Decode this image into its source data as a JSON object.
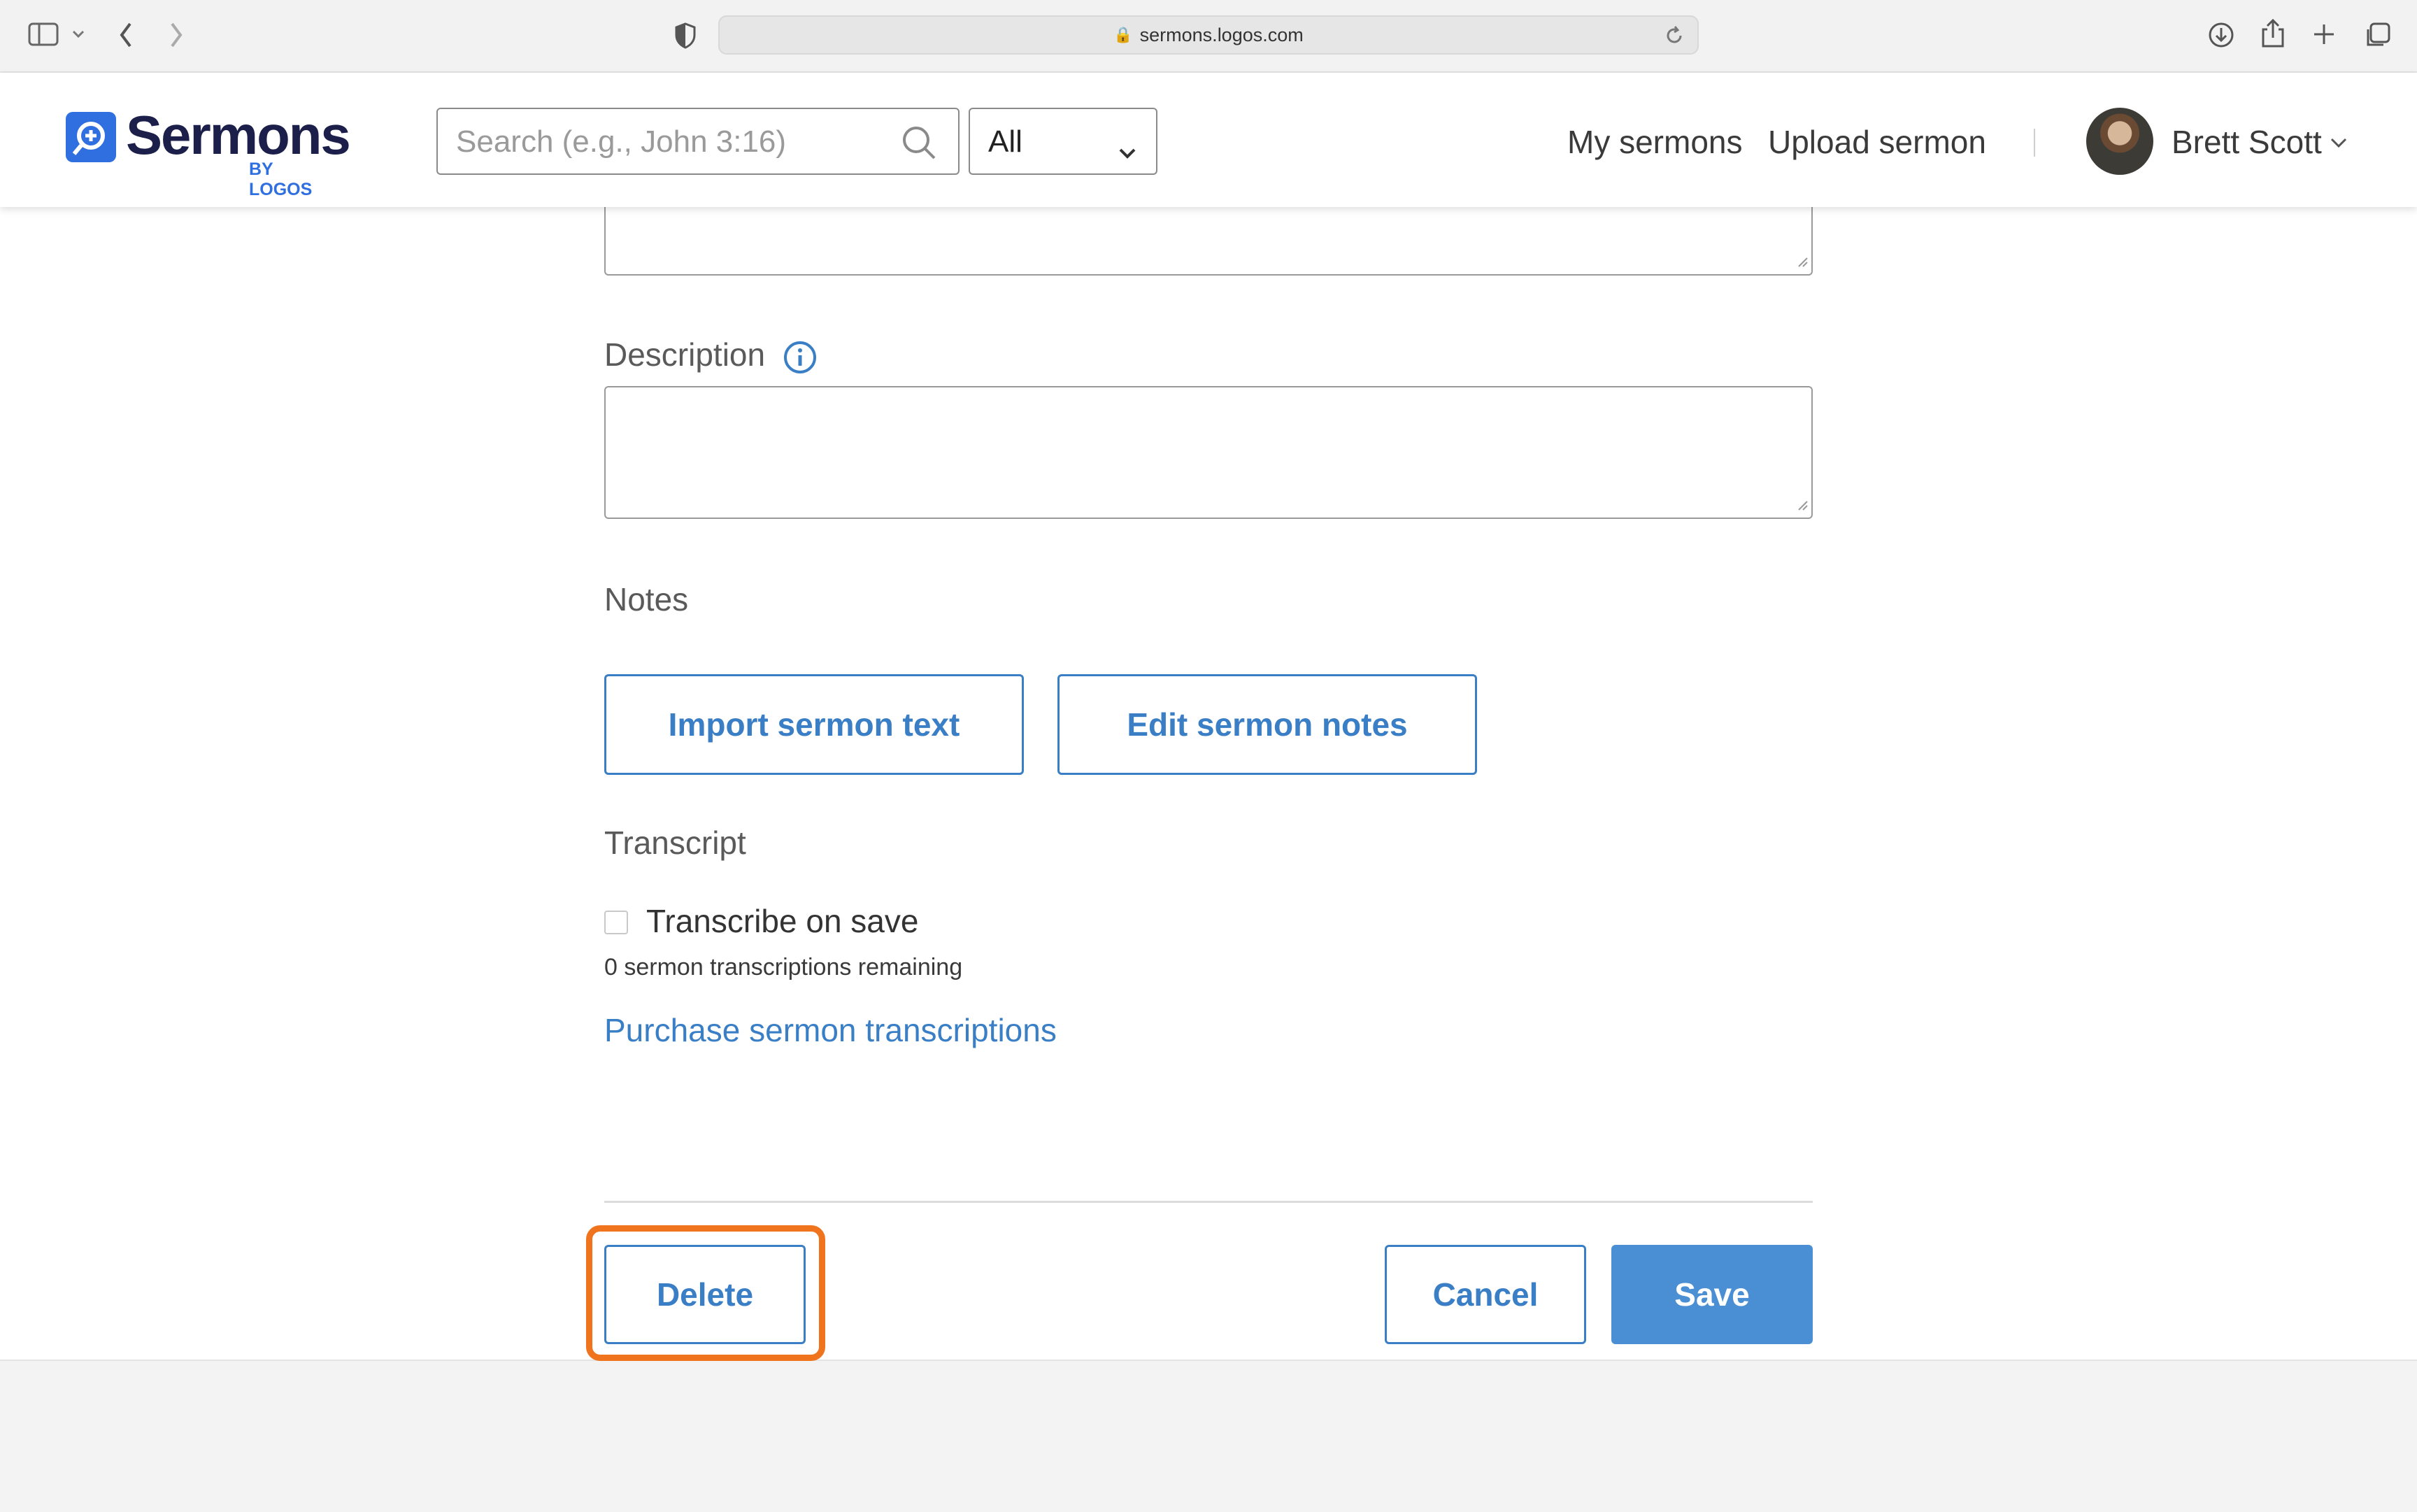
{
  "browser": {
    "url": "sermons.logos.com"
  },
  "header": {
    "logo_text": "Sermons",
    "logo_sub": "BY LOGOS",
    "search_placeholder": "Search (e.g., John 3:16)",
    "scope_value": "All",
    "nav": {
      "my_sermons": "My sermons",
      "upload_sermon": "Upload sermon"
    },
    "user_name": "Brett Scott"
  },
  "form": {
    "description_label": "Description",
    "description_value": "",
    "notes_label": "Notes",
    "import_button": "Import sermon text",
    "edit_notes_button": "Edit sermon notes",
    "transcript_label": "Transcript",
    "transcribe_label": "Transcribe on save",
    "transcribe_checked": false,
    "remaining_text": "0 sermon transcriptions remaining",
    "purchase_link": "Purchase sermon transcriptions",
    "delete_button": "Delete",
    "cancel_button": "Cancel",
    "save_button": "Save"
  },
  "colors": {
    "accent": "#3a7fc6",
    "primary_button": "#4a8fd4",
    "highlight": "#f0741e",
    "brand": "#2f6fe0"
  }
}
